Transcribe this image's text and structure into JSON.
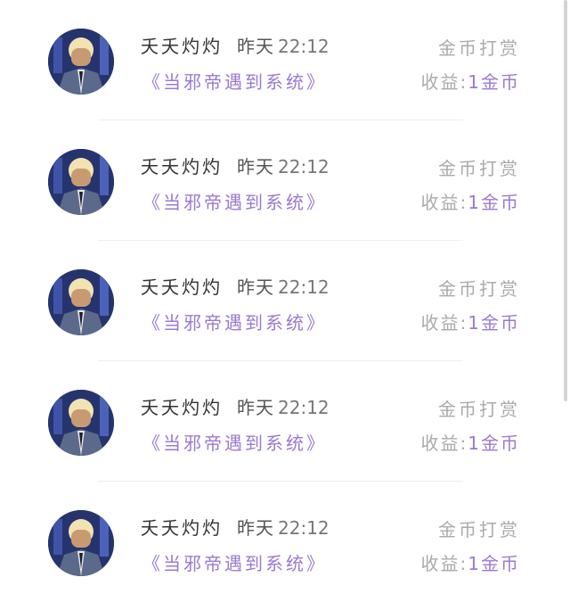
{
  "rows": [
    {
      "user": "夭夭灼灼",
      "day": "昨天",
      "clock": "22:12",
      "book": "《当邪帝遇到系统》",
      "action": "金币打赏",
      "income_label": "收益:",
      "income_value": "1金币"
    },
    {
      "user": "夭夭灼灼",
      "day": "昨天",
      "clock": "22:12",
      "book": "《当邪帝遇到系统》",
      "action": "金币打赏",
      "income_label": "收益:",
      "income_value": "1金币"
    },
    {
      "user": "夭夭灼灼",
      "day": "昨天",
      "clock": "22:12",
      "book": "《当邪帝遇到系统》",
      "action": "金币打赏",
      "income_label": "收益:",
      "income_value": "1金币"
    },
    {
      "user": "夭夭灼灼",
      "day": "昨天",
      "clock": "22:12",
      "book": "《当邪帝遇到系统》",
      "action": "金币打赏",
      "income_label": "收益:",
      "income_value": "1金币"
    },
    {
      "user": "夭夭灼灼",
      "day": "昨天",
      "clock": "22:12",
      "book": "《当邪帝遇到系统》",
      "action": "金币打赏",
      "income_label": "收益:",
      "income_value": "1金币"
    }
  ],
  "colors": {
    "accent": "#9b7ad0",
    "muted": "#aaaaaa",
    "text": "#333333"
  }
}
